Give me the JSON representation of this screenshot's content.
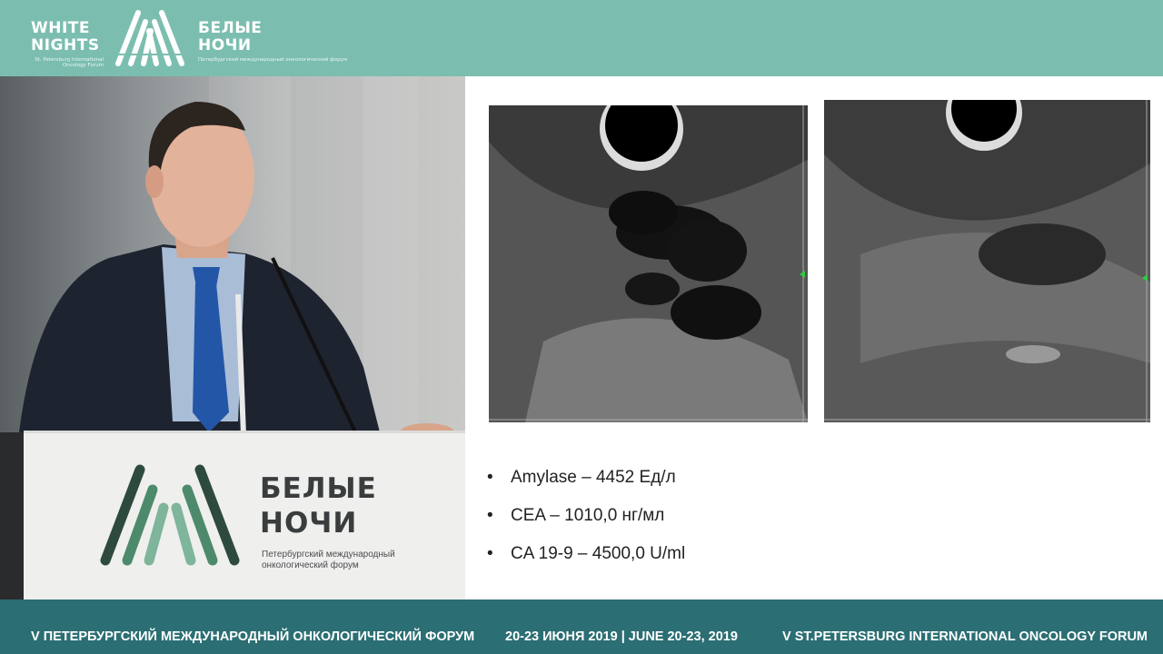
{
  "header": {
    "logo_en": {
      "line1": "WHITE",
      "line2": "NIGHTS",
      "sub": "St. Petersburg International Oncology Forum"
    },
    "logo_ru": {
      "line1": "БЕЛЫЕ",
      "line2": "НОЧИ",
      "sub": "Петербургский международный онкологический форум"
    },
    "banner_color": "#7bbeaf"
  },
  "podium": {
    "title_line1": "БЕЛЫЕ",
    "title_line2": "НОЧИ",
    "subtitle": "Петербургский международный онкологический форум"
  },
  "slide": {
    "bullets": [
      "Amylase – 4452 Ед/л",
      "CEA – 1010,0 нг/мл",
      "CA 19-9 – 4500,0 U/ml"
    ],
    "images": [
      {
        "icon": "ultrasound-image-cystic-lesion"
      },
      {
        "icon": "ultrasound-image-follow-up"
      }
    ]
  },
  "footer": {
    "forum_ru": "V ПЕТЕРБУРГСКИЙ МЕЖДУНАРОДНЫЙ ОНКОЛОГИЧЕСКИЙ ФОРУМ",
    "dates": "20-23 ИЮНЯ 2019 | JUNE 20-23, 2019",
    "forum_en": "V ST.PETERSBURG INTERNATIONAL ONCOLOGY FORUM",
    "banner_color": "#2b6e73"
  }
}
